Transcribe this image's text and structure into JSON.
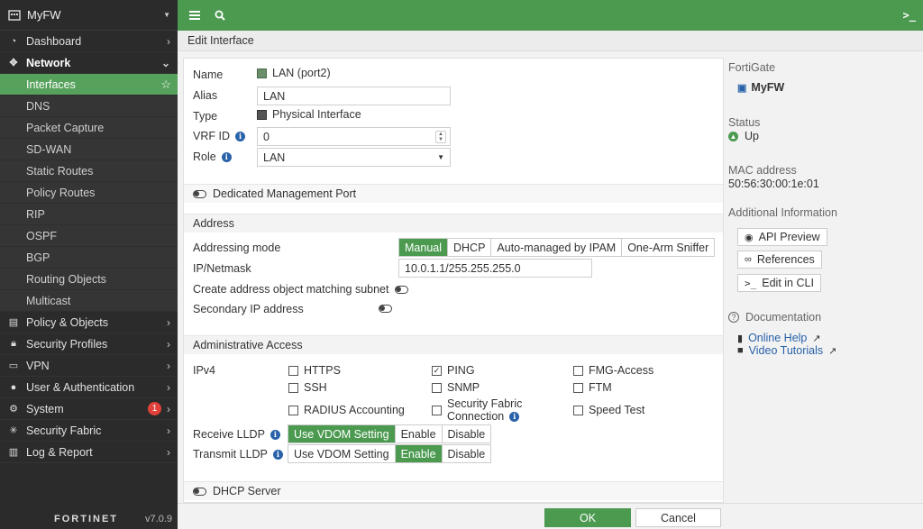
{
  "sidebar": {
    "device": "MyFW",
    "items": [
      {
        "label": "Dashboard",
        "icon": "dashboard-icon"
      },
      {
        "label": "Network",
        "icon": "network-icon"
      },
      {
        "label": "Policy & Objects",
        "icon": "policy-icon"
      },
      {
        "label": "Security Profiles",
        "icon": "lock-icon"
      },
      {
        "label": "VPN",
        "icon": "laptop-icon"
      },
      {
        "label": "User & Authentication",
        "icon": "user-icon"
      },
      {
        "label": "System",
        "icon": "gear-icon",
        "badge": "1"
      },
      {
        "label": "Security Fabric",
        "icon": "fabric-icon"
      },
      {
        "label": "Log & Report",
        "icon": "chart-icon"
      }
    ],
    "network_sub": [
      "Interfaces",
      "DNS",
      "Packet Capture",
      "SD-WAN",
      "Static Routes",
      "Policy Routes",
      "RIP",
      "OSPF",
      "BGP",
      "Routing Objects",
      "Multicast"
    ],
    "brand": "FORTINET",
    "version": "v7.0.9"
  },
  "topbar": {
    "cli": ">_"
  },
  "breadcrumb": "Edit Interface",
  "form": {
    "name_label": "Name",
    "name_value": "LAN (port2)",
    "alias_label": "Alias",
    "alias_value": "LAN",
    "type_label": "Type",
    "type_value": "Physical Interface",
    "vrf_label": "VRF ID",
    "vrf_value": "0",
    "role_label": "Role",
    "role_value": "LAN",
    "dedicated_mgmt": "Dedicated Management Port",
    "address_section": "Address",
    "addr_mode_label": "Addressing mode",
    "addr_modes": [
      "Manual",
      "DHCP",
      "Auto-managed by IPAM",
      "One-Arm Sniffer"
    ],
    "ip_label": "IP/Netmask",
    "ip_value": "10.0.1.1/255.255.255.0",
    "create_addr_label": "Create address object matching subnet",
    "secondary_ip_label": "Secondary IP address",
    "admin_section": "Administrative Access",
    "ipv4_label": "IPv4",
    "access": {
      "https": "HTTPS",
      "ping": "PING",
      "fmg": "FMG-Access",
      "ssh": "SSH",
      "snmp": "SNMP",
      "ftm": "FTM",
      "radius": "RADIUS Accounting",
      "fabric_line1": "Security Fabric",
      "fabric_line2": "Connection",
      "speed": "Speed Test"
    },
    "receive_lldp_label": "Receive LLDP",
    "transmit_lldp_label": "Transmit LLDP",
    "lldp_options": [
      "Use VDOM Setting",
      "Enable",
      "Disable"
    ],
    "dhcp_server": "DHCP Server"
  },
  "right": {
    "fortigate_label": "FortiGate",
    "fortigate_value": "MyFW",
    "status_label": "Status",
    "status_value": "Up",
    "mac_label": "MAC address",
    "mac_value": "50:56:30:00:1e:01",
    "additional_label": "Additional Information",
    "api_preview": "API Preview",
    "references": "References",
    "edit_cli": "Edit in CLI",
    "documentation": "Documentation",
    "online_help": "Online Help",
    "video_tutorials": "Video Tutorials"
  },
  "buttons": {
    "ok": "OK",
    "cancel": "Cancel"
  },
  "colors": {
    "accent": "#4b9a50",
    "sidebar_bg": "#2b2b2b",
    "link": "#2962a8",
    "badge": "#e0413a"
  }
}
